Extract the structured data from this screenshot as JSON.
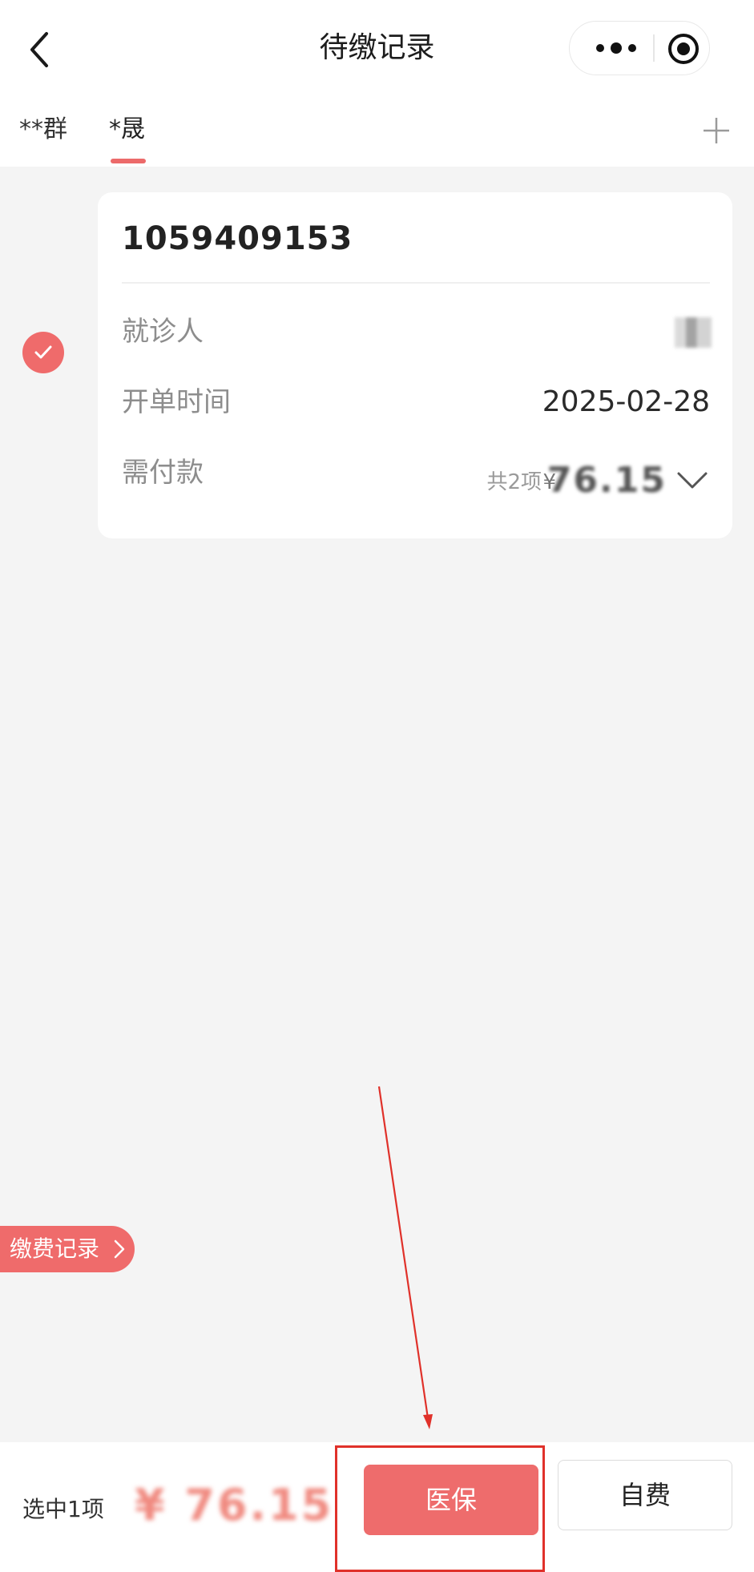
{
  "header": {
    "title": "待缴记录",
    "back_icon": "chevron-left-icon",
    "more_icon": "more-dots-icon",
    "target_icon": "target-icon"
  },
  "tabs": [
    {
      "label": "**群",
      "active": false
    },
    {
      "label": "*晟",
      "active": true
    }
  ],
  "add_icon": "plus-icon",
  "record": {
    "selected": true,
    "number": "1059409153",
    "rows": {
      "patient_label": "就诊人",
      "patient_value": "*晟",
      "date_label": "开单时间",
      "date_value": "2025-02-28",
      "payment_label": "需付款",
      "payment_count": "共2项",
      "currency": "¥",
      "payment_amount": "76.15"
    }
  },
  "history_button": {
    "label": "缴费记录"
  },
  "footer": {
    "selected_text": "选中1项",
    "selected_amount": "¥ 76.15",
    "medical_insurance_button": "医保",
    "self_pay_button": "自费"
  },
  "colors": {
    "accent": "#ee6c6c",
    "highlight_border": "#e0312a",
    "background": "#f4f4f4"
  }
}
